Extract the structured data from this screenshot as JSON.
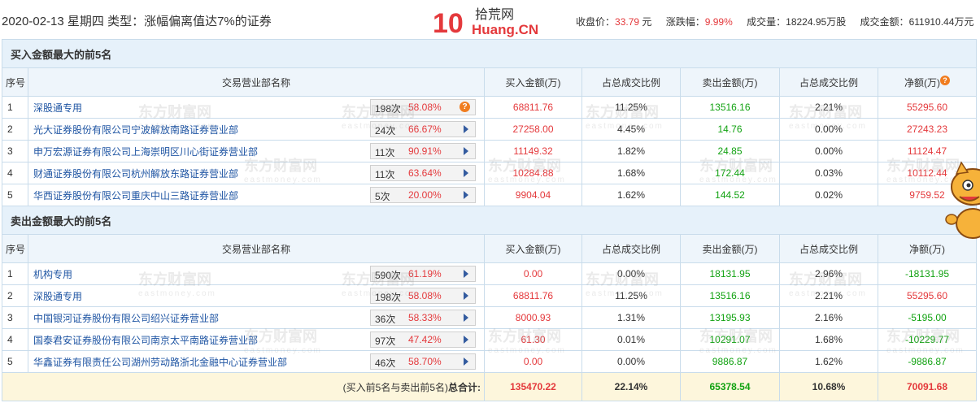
{
  "header": {
    "date_line": "2020-02-13 星期四  类型：涨幅偏离值达7%的证券",
    "logo_num": "10",
    "logo_cn": "拾荒网",
    "logo_en": "Huang.CN",
    "close_label": "收盘价：",
    "close_value": "33.79",
    "close_unit": " 元",
    "change_label": "涨跌幅：",
    "change_value": "9.99%",
    "volume_label": "成交量：",
    "volume_value": "18224.95万股",
    "amount_label": "成交金额：",
    "amount_value": "611910.44万元"
  },
  "buy_section": {
    "title": "买入金额最大的前5名",
    "columns": [
      "序号",
      "交易营业部名称",
      "买入金额(万)",
      "占总成交比例",
      "卖出金额(万)",
      "占总成交比例",
      "净额(万)"
    ],
    "rows": [
      {
        "no": "1",
        "name": "深股通专用",
        "count": "198次",
        "pct": "58.08%",
        "buy": "68811.76",
        "buy_ratio": "11.25%",
        "sell": "13516.16",
        "sell_ratio": "2.21%",
        "net": "55295.60"
      },
      {
        "no": "2",
        "name": "光大证券股份有限公司宁波解放南路证券营业部",
        "count": "24次",
        "pct": "66.67%",
        "buy": "27258.00",
        "buy_ratio": "4.45%",
        "sell": "14.76",
        "sell_ratio": "0.00%",
        "net": "27243.23"
      },
      {
        "no": "3",
        "name": "申万宏源证券有限公司上海崇明区川心街证券营业部",
        "count": "11次",
        "pct": "90.91%",
        "buy": "11149.32",
        "buy_ratio": "1.82%",
        "sell": "24.85",
        "sell_ratio": "0.00%",
        "net": "11124.47"
      },
      {
        "no": "4",
        "name": "财通证券股份有限公司杭州解放东路证券营业部",
        "count": "11次",
        "pct": "63.64%",
        "buy": "10284.88",
        "buy_ratio": "1.68%",
        "sell": "172.44",
        "sell_ratio": "0.03%",
        "net": "10112.44"
      },
      {
        "no": "5",
        "name": "华西证券股份有限公司重庆中山三路证券营业部",
        "count": "5次",
        "pct": "20.00%",
        "buy": "9904.04",
        "buy_ratio": "1.62%",
        "sell": "144.52",
        "sell_ratio": "0.02%",
        "net": "9759.52"
      }
    ]
  },
  "sell_section": {
    "title": "卖出金额最大的前5名",
    "columns": [
      "序号",
      "交易营业部名称",
      "买入金额(万)",
      "占总成交比例",
      "卖出金额(万)",
      "占总成交比例",
      "净额(万)"
    ],
    "rows": [
      {
        "no": "1",
        "name": "机构专用",
        "count": "590次",
        "pct": "61.19%",
        "buy": "0.00",
        "buy_ratio": "0.00%",
        "sell": "18131.95",
        "sell_ratio": "2.96%",
        "net": "-18131.95"
      },
      {
        "no": "2",
        "name": "深股通专用",
        "count": "198次",
        "pct": "58.08%",
        "buy": "68811.76",
        "buy_ratio": "11.25%",
        "sell": "13516.16",
        "sell_ratio": "2.21%",
        "net": "55295.60"
      },
      {
        "no": "3",
        "name": "中国银河证券股份有限公司绍兴证券营业部",
        "count": "36次",
        "pct": "58.33%",
        "buy": "8000.93",
        "buy_ratio": "1.31%",
        "sell": "13195.93",
        "sell_ratio": "2.16%",
        "net": "-5195.00"
      },
      {
        "no": "4",
        "name": "国泰君安证券股份有限公司南京太平南路证券营业部",
        "count": "97次",
        "pct": "47.42%",
        "buy": "61.30",
        "buy_ratio": "0.01%",
        "sell": "10291.07",
        "sell_ratio": "1.68%",
        "net": "-10229.77"
      },
      {
        "no": "5",
        "name": "华鑫证券有限责任公司湖州劳动路浙北金融中心证券营业部",
        "count": "46次",
        "pct": "58.70%",
        "buy": "0.00",
        "buy_ratio": "0.00%",
        "sell": "9886.87",
        "sell_ratio": "1.62%",
        "net": "-9886.87"
      }
    ]
  },
  "total": {
    "label_prefix": "(买入前5名与卖出前5名)",
    "label_bold": "总合计:",
    "buy": "135470.22",
    "buy_ratio": "22.14%",
    "sell": "65378.54",
    "sell_ratio": "10.68%",
    "net": "70091.68"
  },
  "watermark": {
    "cn": "东方财富网",
    "en": "eastmoney.com"
  },
  "colors": {
    "up": "#e4393c",
    "down": "#11a211",
    "link": "#1f55a3",
    "header_bg": "#e6f1fa",
    "total_bg": "#fdf6dc"
  },
  "icons": {
    "help": "question-mark-icon",
    "expand": "play-arrow-icon"
  }
}
